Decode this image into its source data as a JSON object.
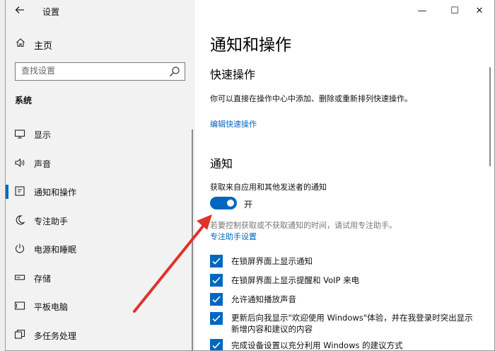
{
  "window": {
    "title": "设置",
    "back_icon": "arrow-left-icon",
    "controls": {
      "minimize": "—",
      "maximize": "☐",
      "close": "✕"
    }
  },
  "sidebar": {
    "home_label": "主页",
    "search_placeholder": "查找设置",
    "section": "系统",
    "items": [
      {
        "label": "显示",
        "icon": "display-icon"
      },
      {
        "label": "声音",
        "icon": "speaker-icon"
      },
      {
        "label": "通知和操作",
        "icon": "notification-icon",
        "active": true
      },
      {
        "label": "专注助手",
        "icon": "moon-icon"
      },
      {
        "label": "电源和睡眠",
        "icon": "power-icon"
      },
      {
        "label": "存储",
        "icon": "storage-icon"
      },
      {
        "label": "平板电脑",
        "icon": "tablet-icon"
      },
      {
        "label": "多任务处理",
        "icon": "multitask-icon"
      }
    ]
  },
  "main": {
    "page_title": "通知和操作",
    "quick_actions": {
      "heading": "快速操作",
      "description": "你可以直接在操作中心中添加、删除或重新排列快速操作。",
      "edit_link": "编辑快速操作"
    },
    "notifications": {
      "heading": "通知",
      "get_label": "获取来自应用和其他发送者的通知",
      "toggle_state": "开",
      "toggle_on": true,
      "hint": "若要控制获取或不获取通知的时间，请试用专注助手。",
      "focus_link": "专注助手设置",
      "checkboxes": [
        {
          "label": "在锁屏界面上显示通知",
          "checked": true
        },
        {
          "label": "在锁屏界面上显示提醒和 VoIP 来电",
          "checked": true
        },
        {
          "label": "允许通知播放声音",
          "checked": true
        },
        {
          "label": "更新后向我显示\"欢迎使用 Windows\"体验，并在我登录时突出显示新增内容和建议的内容",
          "line1": "更新后向我显示\"欢迎使用 Windows\"体验，并在我登录时突出显示",
          "line2": "新增内容和建议的内容",
          "checked": true
        },
        {
          "label": "完成设备设置以充分利用 Windows 的建议方式",
          "checked": true
        }
      ]
    }
  },
  "colors": {
    "accent": "#0067c0",
    "arrow": "#e0322a"
  }
}
